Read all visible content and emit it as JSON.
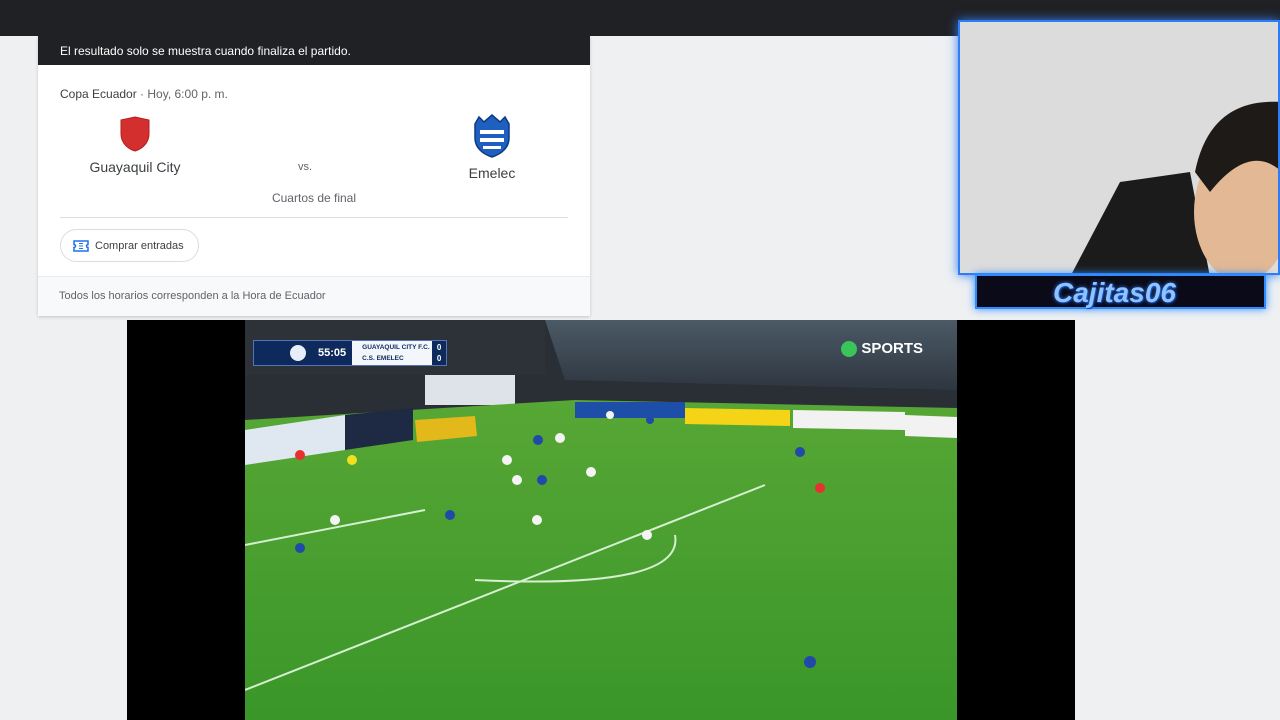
{
  "match_card": {
    "notice": "El resultado solo se muestra cuando finaliza el partido.",
    "competition": "Copa Ecuador",
    "separator": " · ",
    "datetime": "Hoy, 6:00 p. m.",
    "home_team": "Guayaquil City",
    "away_team": "Emelec",
    "vs_label": "vs.",
    "stage": "Cuartos de final",
    "tickets_button": "Comprar entradas",
    "footer": "Todos los horarios corresponden a la Hora de Ecuador"
  },
  "video": {
    "clock": "55:05",
    "home_team": "GUAYAQUIL CITY F.C.",
    "away_team": "C.S. EMELEC",
    "home_score": "0",
    "away_score": "0",
    "broadcaster": "SPORTS"
  },
  "overlay": {
    "streamer_name": "Cajitas06"
  },
  "icons": {
    "home_crest": "red-shield-icon",
    "away_crest": "emelec-crest-icon",
    "ticket": "ticket-icon",
    "ball": "ball-icon"
  },
  "colors": {
    "pitch": "#3f9b2d",
    "scoreboard": "#0e2a5c",
    "accent_blue": "#2f7cf5",
    "home_red": "#d32f2f"
  }
}
